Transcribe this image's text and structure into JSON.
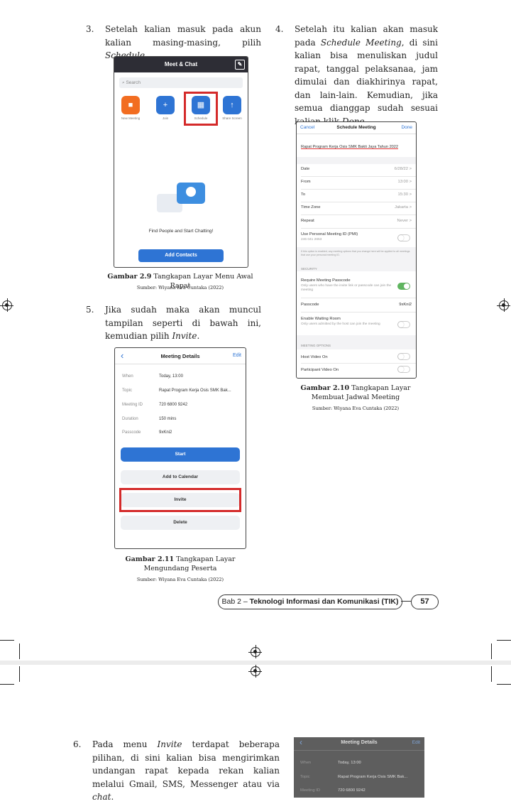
{
  "step3": {
    "num": "3.",
    "text_a": "Setelah kalian masuk pada akun kalian masing-masing, pilih ",
    "text_it": "Schedule",
    "text_b": "."
  },
  "step4": {
    "num": "4.",
    "text_a": "Setelah itu kalian akan masuk pada ",
    "text_it": "Schedule Meeting",
    "text_b": ", di sini kalian bisa menuliskan judul rapat, tanggal pelaksanaa, jam dimulai dan diakhirinya rapat, dan lain-lain. Kemudian, jika semua dianggap sudah sesuai kalian klik ",
    "text_it2": "Done",
    "text_c": "."
  },
  "step5": {
    "num": "5.",
    "text_a": "Jika sudah maka akan muncul tampilan seperti di bawah ini, kemudian pilih ",
    "text_it": "Invite",
    "text_b": "."
  },
  "step6": {
    "num": "6.",
    "text_a": "Pada menu ",
    "text_it": "Invite",
    "text_b": " terdapat beberapa pilihan, di sini kalian bisa mengirimkan undangan rapat kepada rekan kalian melalui Gmail, SMS, Messenger atau via ",
    "text_it2": "chat",
    "text_c": "."
  },
  "meet_chat": {
    "title": "Meet & Chat",
    "search_placeholder": "Search",
    "actions": [
      {
        "label": "New Meeting",
        "color": "#f26d21"
      },
      {
        "label": "Join",
        "color": "#2e74d4"
      },
      {
        "label": "Schedule",
        "color": "#2e74d4"
      },
      {
        "label": "Share Screen",
        "color": "#2e74d4"
      }
    ],
    "empty_text": "Find People and Start Chatting!",
    "add_contacts": "Add Contacts"
  },
  "fig29": {
    "label": "Gambar 2.9",
    "title": " Tangkapan Layar Menu Awal Rapat",
    "source": "Sumber: Wiyana Eva Cuntaka (2022)"
  },
  "schedule": {
    "cancel": "Cancel",
    "title": "Schedule Meeting",
    "done": "Done",
    "topic": "Rapat Program Kerja Osis SMK Bakti Jaya Tahun 2022",
    "rows": [
      {
        "label": "Date",
        "value": "6/28/22 >"
      },
      {
        "label": "From",
        "value": "13:00 >"
      },
      {
        "label": "To",
        "value": "15:30 >"
      },
      {
        "label": "Time Zone",
        "value": "Jakarta >"
      },
      {
        "label": "Repeat",
        "value": "Never >"
      }
    ],
    "pmi_label": "Use Personal Meeting ID (PMI)",
    "pmi_value": "246 041 2653",
    "pmi_note": "If this option is enabled, any meeting options that you change here will be applied to all meetings that use your personal meeting ID.",
    "security_header": "SECURITY",
    "passcode_req": "Require Meeting Passcode",
    "passcode_req_sub": "Only users who have the invite link or passcode can join the meeting",
    "passcode_label": "Passcode",
    "passcode_value": "9xKni2",
    "waiting_label": "Enable Waiting Room",
    "waiting_sub": "Only users admitted by the host can join the meeting",
    "options_header": "MEETING OPTIONS",
    "host_video": "Host Video On",
    "participant_video": "Participant Video On"
  },
  "fig210": {
    "label": "Gambar 2.10",
    "title_a": " Tangkapan Layar",
    "title_b": "Membuat Jadwal Meeting",
    "source": "Sumber: Wiyana Eva Cuntaka (2022)"
  },
  "details": {
    "title": "Meeting Details",
    "edit": "Edit",
    "rows": [
      {
        "label": "When",
        "value": "Today, 13:00"
      },
      {
        "label": "Topic",
        "value": "Rapat Program Kerja Osis SMK Bak..."
      },
      {
        "label": "Meeting ID",
        "value": "720 6800 9242"
      },
      {
        "label": "Duration",
        "value": "150 mins"
      },
      {
        "label": "Passcode",
        "value": "9xKni2"
      }
    ],
    "start": "Start",
    "calendar": "Add to Calendar",
    "invite": "Invite",
    "delete": "Delete"
  },
  "fig211": {
    "label": "Gambar 2.11",
    "title_a": " Tangkapan Layar",
    "title_b": "Mengundang Peserta",
    "source": "Sumber: Wiyana Eva Cuntaka (2022)"
  },
  "footer": {
    "chapter_a": "Bab 2 – ",
    "chapter_b": "Teknologi Informasi dan Komunikasi (TIK)",
    "page": "57"
  },
  "details2": {
    "title": "Meeting Details",
    "edit": "Edit",
    "rows": [
      {
        "label": "When",
        "value": "Today, 13:00"
      },
      {
        "label": "Topic",
        "value": "Rapat Program Kerja Osis SMK Bak..."
      },
      {
        "label": "Meeting ID",
        "value": "720 6800 9242"
      }
    ]
  }
}
